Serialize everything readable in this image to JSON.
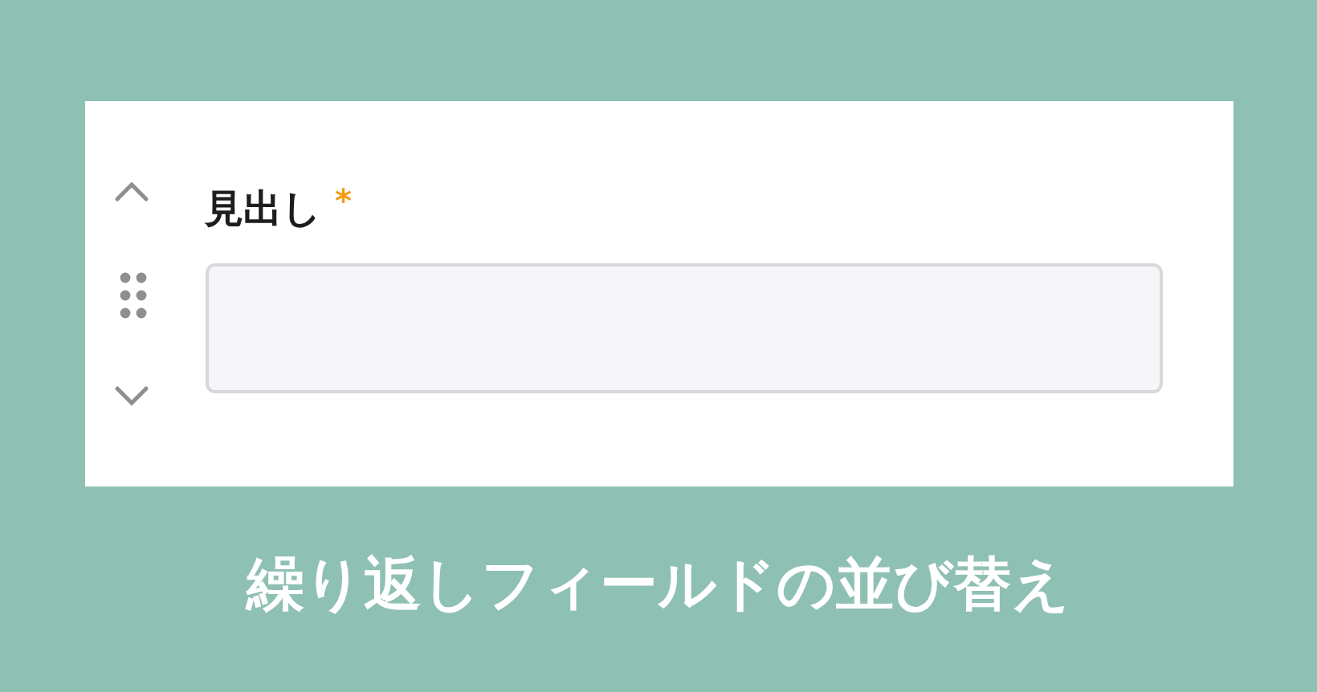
{
  "field": {
    "label": "見出し",
    "required_mark": "*"
  },
  "caption": "繰り返しフィールドの並び替え"
}
